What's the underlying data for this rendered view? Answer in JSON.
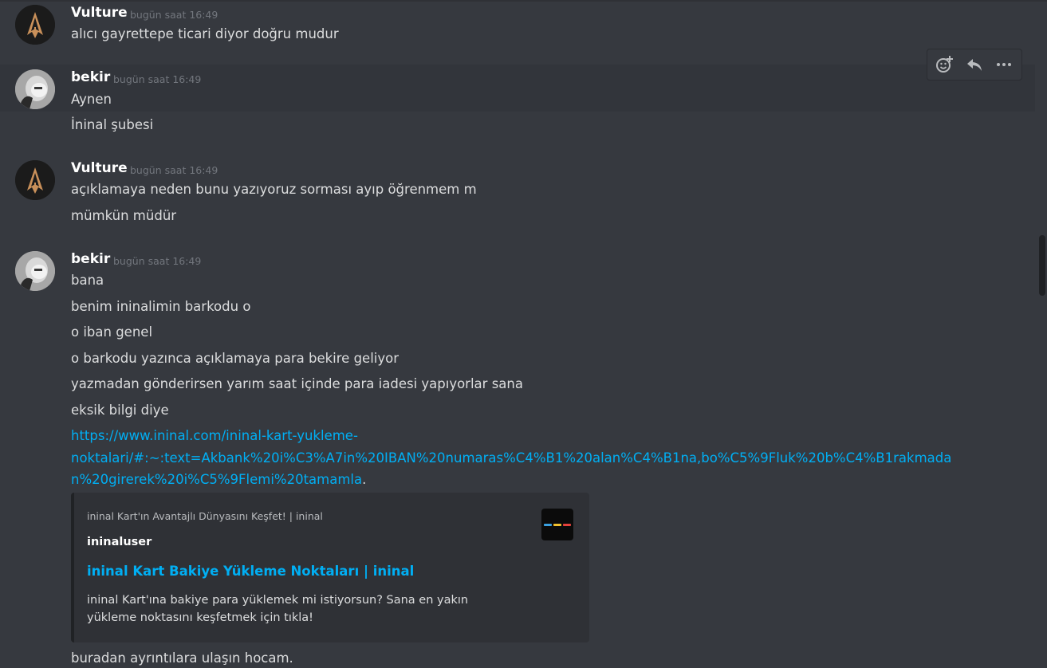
{
  "messages": [
    {
      "author": "Vulture",
      "timestamp": "bugün saat 16:49",
      "lines": [
        "alıcı gayrettepe ticari diyor doğru mudur"
      ]
    },
    {
      "author": "bekir",
      "timestamp": "bugün saat 16:49",
      "lines": [
        "Aynen",
        "İninal şubesi"
      ]
    },
    {
      "author": "Vulture",
      "timestamp": "bugün saat 16:49",
      "lines": [
        "açıklamaya neden bunu yazıyoruz sorması ayıp öğrenmem m",
        "mümkün müdür"
      ]
    },
    {
      "author": "bekir",
      "timestamp": "bugün saat 16:49",
      "lines": [
        "bana",
        "benim ininalimin barkodu o",
        "o iban genel",
        "o barkodu yazınca açıklamaya para bekire geliyor",
        "yazmadan gönderirsen yarım saat içinde para iadesi yapıyorlar sana",
        "eksik bilgi diye"
      ],
      "link_lines": [
        "https://www.ininal.com/ininal-kart-yukleme-",
        "noktalari/#:~:text=Akbank%20i%C3%A7in%20IBAN%20numaras%C4%B1%20alan%C4%B1na,bo%C5%9Fluk%20b%C4%B1rakmada",
        "n%20girerek%20i%C5%9Flemi%20tamamla"
      ],
      "link_trailing": ".",
      "after_embed": "buradan ayrıntılara ulaşın hocam."
    }
  ],
  "embed": {
    "provider": "ininal Kart'ın Avantajlı Dünyasını Keşfet! | ininal",
    "author": "ininaluser",
    "title": "ininal Kart Bakiye Yükleme Noktaları | ininal",
    "description": "ininal Kart'ına bakiye para yüklemek mi istiyorsun? Sana en yakın yükleme noktasını keşfetmek için tıkla!",
    "thumbnail_colors": [
      "#3aa0e0",
      "#f2c12e",
      "#e5423c"
    ]
  },
  "toolbar": {
    "icons": [
      "add-reaction-icon",
      "reply-icon",
      "more-icon"
    ]
  },
  "colors": {
    "background": "#36393f",
    "hover": "#32353b",
    "text": "#dcddde",
    "link": "#00aff4",
    "muted": "#72767d",
    "embed_bg": "#2f3136"
  }
}
